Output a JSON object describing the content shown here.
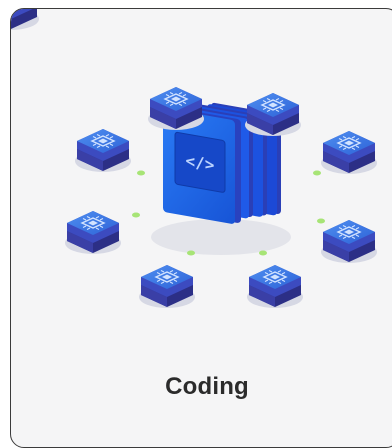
{
  "card": {
    "title": "Coding"
  },
  "illustration": {
    "center_icon": "code-window-stack-icon",
    "center_glyph": "</>",
    "node_icon": "chip-icon",
    "connector_icon": "dot-icon",
    "colors": {
      "accent": "#1f6cf0",
      "node_top": "#3e7de9",
      "node_side": "#313694",
      "dot": "#a7e476"
    }
  }
}
